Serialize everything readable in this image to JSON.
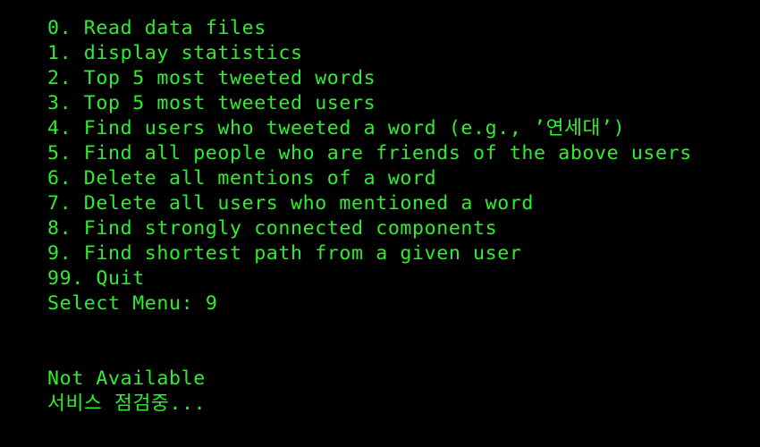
{
  "colors": {
    "background": "#000000",
    "text": "#2bf02b"
  },
  "menu": {
    "items": [
      "0. Read data files",
      "1. display statistics",
      "2. Top 5 most tweeted words",
      "3. Top 5 most tweeted users",
      "4. Find users who tweeted a word (e.g., ’연세대’)",
      "5. Find all people who are friends of the above users",
      "6. Delete all mentions of a word",
      "7. Delete all users who mentioned a word",
      "8. Find strongly connected components",
      "9. Find shortest path from a given user",
      "99. Quit"
    ],
    "prompt_label": "Select Menu: ",
    "prompt_value": "9"
  },
  "output": {
    "line1": "Not Available",
    "line2": "서비스 점검중..."
  }
}
